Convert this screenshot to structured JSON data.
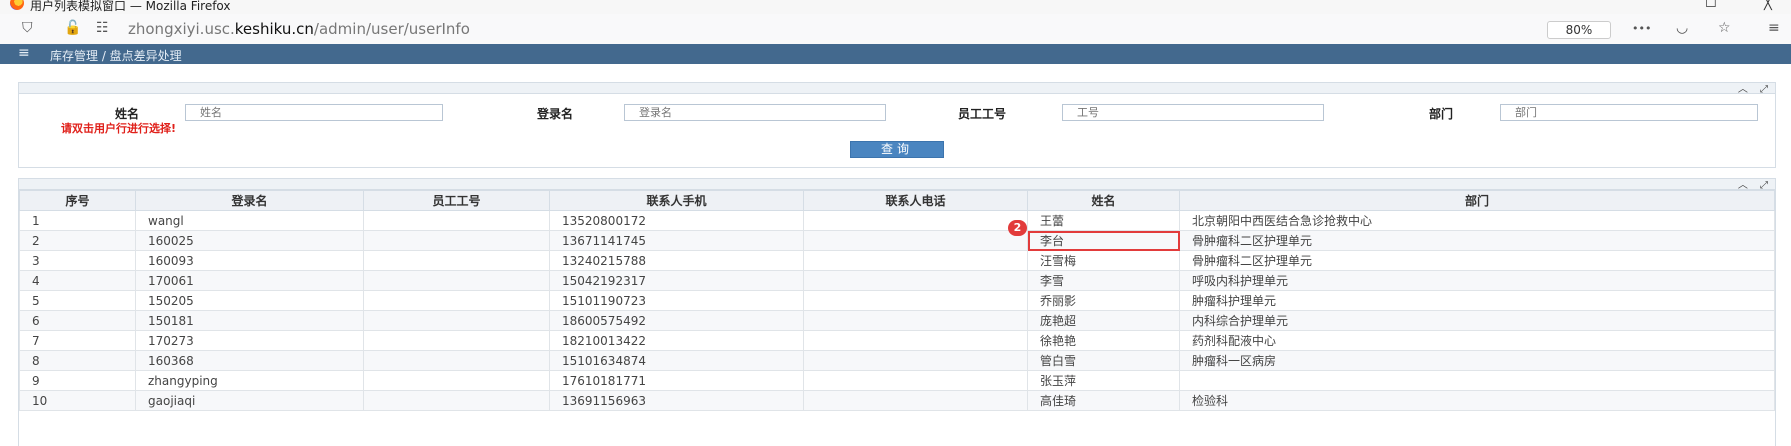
{
  "window": {
    "title": "用户列表模拟窗口 — Mozilla Firefox",
    "minimize": "☐",
    "close": "╳"
  },
  "browser": {
    "url_prefix": "zhongxiyi.usc.",
    "url_domain": "keshiku.cn",
    "url_path": "/admin/user/userInfo",
    "zoom": "80%",
    "more": "•••",
    "icons": [
      "shield-icon",
      "lock-icon",
      "permissions-icon",
      "pocket-icon",
      "star-icon",
      "menu-icon"
    ]
  },
  "nav": {
    "menu": "≡",
    "breadcrumb": "库存管理 / 盘点差异处理"
  },
  "search": {
    "name_label": "姓名",
    "name_placeholder": "姓名",
    "login_label": "登录名",
    "login_placeholder": "登录名",
    "empno_label": "员工工号",
    "empno_placeholder": "工号",
    "dept_label": "部门",
    "dept_placeholder": "部门",
    "hint": "请双击用户行进行选择!",
    "query_button": "查询",
    "collapse": "︿",
    "expand": "⤢"
  },
  "grid": {
    "collapse": "︿",
    "expand": "⤢",
    "columns": [
      "序号",
      "登录名",
      "员工工号",
      "联系人手机",
      "联系人电话",
      "姓名",
      "部门"
    ],
    "rows": [
      [
        "1",
        "wangl",
        "",
        "13520800172",
        "",
        "王蕾",
        "北京朝阳中西医结合急诊抢救中心"
      ],
      [
        "2",
        "160025",
        "",
        "13671141745",
        "",
        "李台",
        "骨肿瘤科二区护理单元"
      ],
      [
        "3",
        "160093",
        "",
        "13240215788",
        "",
        "汪雪梅",
        "骨肿瘤科二区护理单元"
      ],
      [
        "4",
        "170061",
        "",
        "15042192317",
        "",
        "李雪",
        "呼吸内科护理单元"
      ],
      [
        "5",
        "150205",
        "",
        "15101190723",
        "",
        "乔丽影",
        "肿瘤科护理单元"
      ],
      [
        "6",
        "150181",
        "",
        "18600575492",
        "",
        "庞艳超",
        "内科综合护理单元"
      ],
      [
        "7",
        "170273",
        "",
        "18210013422",
        "",
        "徐艳艳",
        "药剂科配液中心"
      ],
      [
        "8",
        "160368",
        "",
        "15101634874",
        "",
        "管白雪",
        "肿瘤科一区病房"
      ],
      [
        "9",
        "zhangyping",
        "",
        "17610181771",
        "",
        "张玉萍",
        ""
      ],
      [
        "10",
        "gaojiaqi",
        "",
        "13691156963",
        "",
        "高佳琦",
        "检验科"
      ]
    ],
    "highlight_marker": "2"
  }
}
